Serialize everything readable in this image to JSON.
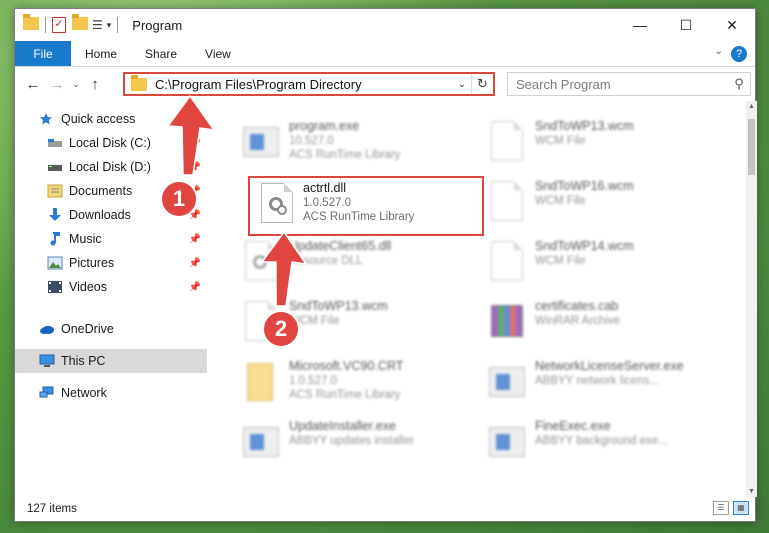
{
  "window": {
    "title": "Program",
    "controls": {
      "minimize": "—",
      "maximize": "☐",
      "close": "✕"
    }
  },
  "ribbon": {
    "file": "File",
    "tabs": [
      "Home",
      "Share",
      "View"
    ],
    "help": "?",
    "collapse": "⌄"
  },
  "nav": {
    "back": "←",
    "forward": "→",
    "recent": "⌄",
    "up": "↑",
    "address": "C:\\Program Files\\Program Directory",
    "search_placeholder": "Search Program",
    "search_glyph": "⚲",
    "refresh_glyph": "↻",
    "dropdown_glyph": "⌄"
  },
  "sidebar": {
    "items": [
      {
        "label": "Quick access",
        "icon": "star-icon",
        "pinned": false
      },
      {
        "label": "Local Disk (C:)",
        "icon": "drive-icon",
        "pinned": true
      },
      {
        "label": "Local Disk (D:)",
        "icon": "drive-icon",
        "pinned": true
      },
      {
        "label": "Documents",
        "icon": "documents-icon",
        "pinned": true
      },
      {
        "label": "Downloads",
        "icon": "downloads-icon",
        "pinned": true
      },
      {
        "label": "Music",
        "icon": "music-icon",
        "pinned": true
      },
      {
        "label": "Pictures",
        "icon": "pictures-icon",
        "pinned": true
      },
      {
        "label": "Videos",
        "icon": "videos-icon",
        "pinned": true
      },
      {
        "label": "OneDrive",
        "icon": "onedrive-icon",
        "pinned": false
      },
      {
        "label": "This PC",
        "icon": "this-pc-icon",
        "pinned": false,
        "selected": true
      },
      {
        "label": "Network",
        "icon": "network-icon",
        "pinned": false
      }
    ]
  },
  "files": [
    {
      "name": "program.exe",
      "line1": "10.527.0",
      "line2": "ACS RunTime Library",
      "icon": "exe-icon",
      "blurred": true
    },
    {
      "name": "SndToWP13.wcm",
      "line1": "WCM File",
      "line2": "",
      "icon": "document-icon",
      "blurred": true
    },
    {
      "name": "actrtl.dll",
      "line1": "1.0.527.0",
      "line2": "ACS RunTime Library",
      "icon": "dll-gear-icon",
      "blurred": false
    },
    {
      "name": "SndToWP16.wcm",
      "line1": "WCM File",
      "line2": "",
      "icon": "document-icon",
      "blurred": true
    },
    {
      "name": "UpdateClient65.dll",
      "line1": "Resource DLL",
      "line2": "",
      "icon": "dll-gear-icon",
      "blurred": true
    },
    {
      "name": "SndToWP14.wcm",
      "line1": "WCM File",
      "line2": "",
      "icon": "document-icon",
      "blurred": true
    },
    {
      "name": "SndToWP13.wcm",
      "line1": "WCM File",
      "line2": "",
      "icon": "document-icon",
      "blurred": true
    },
    {
      "name": "certificates.cab",
      "line1": "WinRAR Archive",
      "line2": "",
      "icon": "archive-icon",
      "blurred": true
    },
    {
      "name": "Microsoft.VC90.CRT",
      "line1": "1.0.527.0",
      "line2": "ACS RunTime Library",
      "icon": "folder-doc-icon",
      "blurred": true
    },
    {
      "name": "NetworkLicenseServer.exe",
      "line1": "ABBYY network licens...",
      "line2": "",
      "icon": "exe-icon",
      "blurred": true
    },
    {
      "name": "UpdateInstaller.exe",
      "line1": "ABBYY updates installer",
      "line2": "",
      "icon": "exe-icon",
      "blurred": true
    },
    {
      "name": "FineExec.exe",
      "line1": "ABBYY background exe...",
      "line2": "",
      "icon": "exe-icon",
      "blurred": true
    }
  ],
  "status": {
    "count": "127 items"
  },
  "annotations": {
    "badge1": "1",
    "badge2": "2",
    "color": "#e0463f"
  },
  "colors": {
    "accent": "#1979ca",
    "highlight": "#d9473f",
    "selected_bg": "#d9d9d9"
  }
}
